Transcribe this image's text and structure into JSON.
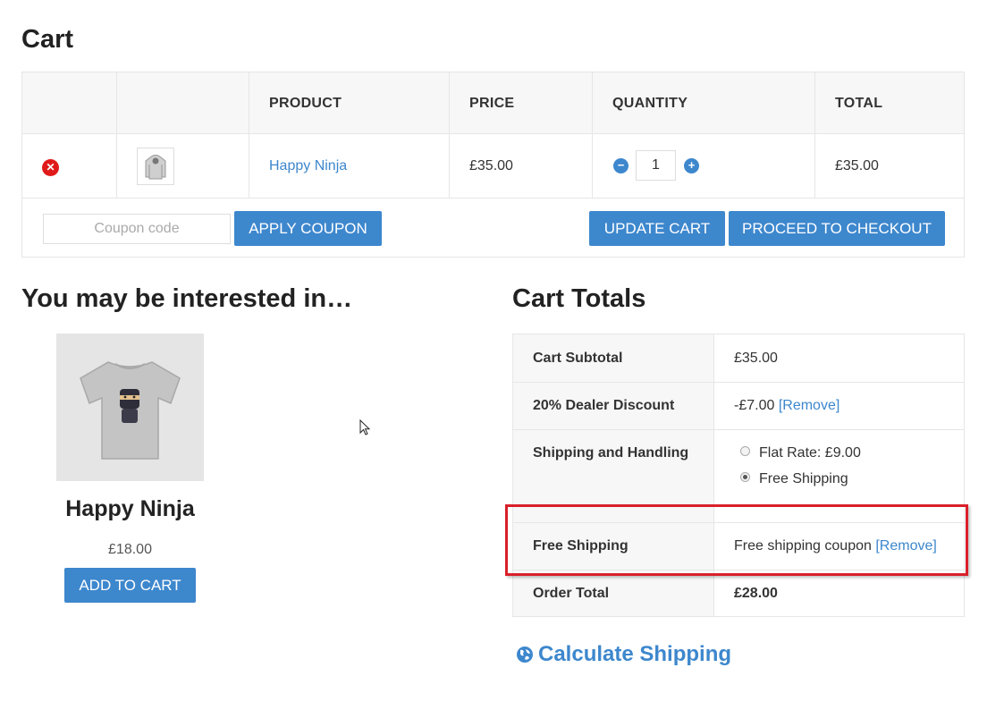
{
  "page": {
    "title": "Cart"
  },
  "cart": {
    "headers": {
      "product": "PRODUCT",
      "price": "PRICE",
      "quantity": "QUANTITY",
      "total": "TOTAL"
    },
    "item": {
      "name": "Happy Ninja",
      "price": "£35.00",
      "quantity": "1",
      "total": "£35.00",
      "thumbnail": "hoodie-thumbnail"
    },
    "coupon_placeholder": "Coupon code",
    "apply_coupon_label": "APPLY COUPON",
    "update_cart_label": "UPDATE CART",
    "checkout_label": "PROCEED TO CHECKOUT"
  },
  "related": {
    "heading": "You may be interested in…",
    "product": {
      "name": "Happy Ninja",
      "price": "£18.00",
      "add_to_cart_label": "ADD TO CART",
      "image": "ninja-tshirt-image"
    }
  },
  "totals": {
    "heading": "Cart Totals",
    "subtotal_label": "Cart Subtotal",
    "subtotal_value": "£35.00",
    "discount_label": "20% Dealer Discount",
    "discount_value": "-£7.00",
    "discount_remove": "[Remove]",
    "shipping_label": "Shipping and Handling",
    "shipping_options": [
      "Flat Rate: £9.00",
      "Free Shipping"
    ],
    "shipping_selected": "Free Shipping",
    "free_shipping_label": "Free Shipping",
    "free_shipping_value": "Free shipping coupon",
    "free_shipping_remove": "[Remove]",
    "order_total_label": "Order Total",
    "order_total_value": "£28.00",
    "calc_shipping_label": "Calculate Shipping"
  },
  "colors": {
    "accent": "#3d87cd",
    "remove": "#e01a1a",
    "highlight": "#d9202a"
  }
}
